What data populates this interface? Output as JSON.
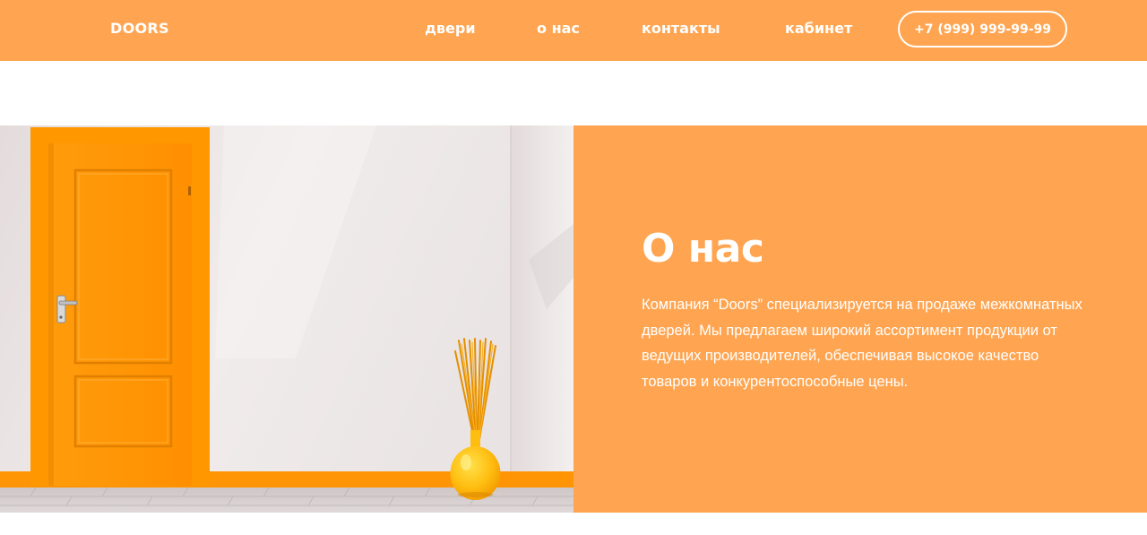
{
  "header": {
    "logo": "DOORS",
    "nav": [
      "двери",
      "о нас",
      "контакты",
      "кабинет"
    ],
    "phone": "+7 (999) 999-99-99"
  },
  "about": {
    "title": "О нас",
    "text": "Компания “Doors” специализируется на продаже межкомнатных дверей. Мы предлагаем широкий ассортимент продукции от ведущих производителей, обеспечивая высокое качество товаров и конкурентоспособные цены."
  },
  "colors": {
    "accent": "#ffa551",
    "door": "#ff9a0f",
    "wall": "#ece6e6",
    "floor": "#d7cfcf"
  }
}
